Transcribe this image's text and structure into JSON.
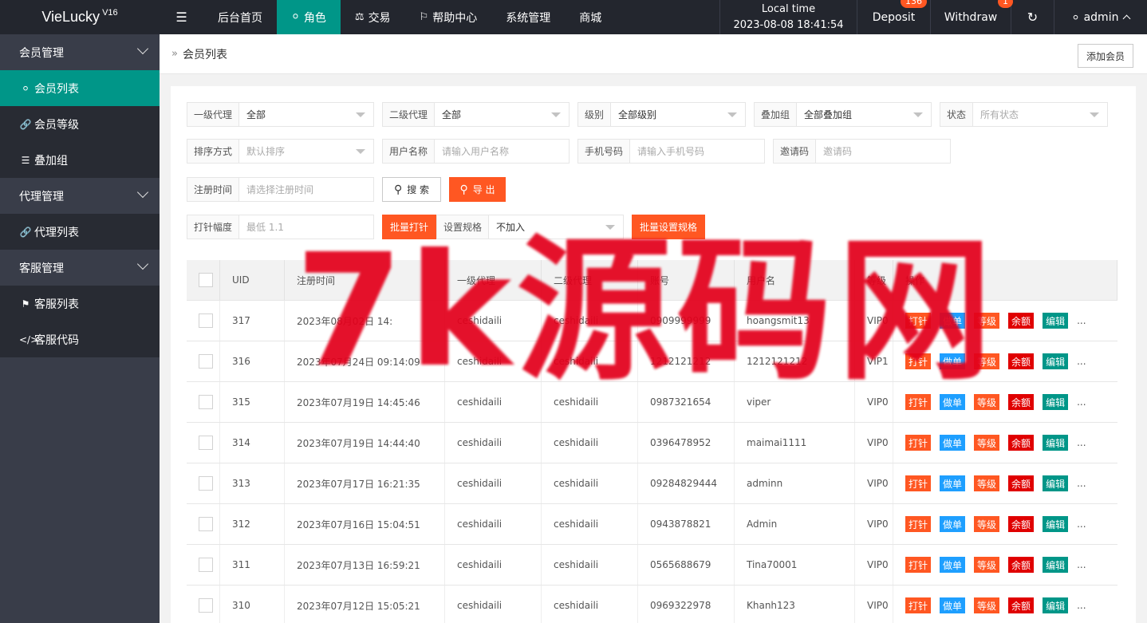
{
  "header": {
    "logo": "VieLucky",
    "logo_version": "V16",
    "menu_toggle_icon": "☰",
    "nav": [
      {
        "label": "后台首页",
        "icon": ""
      },
      {
        "label": "角色",
        "icon": "user-icon"
      },
      {
        "label": "交易",
        "icon": "scale-icon"
      },
      {
        "label": "帮助中心",
        "icon": "flag-icon"
      },
      {
        "label": "系统管理",
        "icon": ""
      },
      {
        "label": "商城",
        "icon": ""
      }
    ],
    "local_time_label": "Local time",
    "local_time_value": "2023-08-08 18:41:54",
    "deposit_label": "Deposit",
    "deposit_badge": "136",
    "withdraw_label": "Withdraw",
    "withdraw_badge": "1",
    "refresh_icon": "↻",
    "user_label": "admin",
    "badge_color": "#ff5722",
    "accent_color": "#009688"
  },
  "sidebar": {
    "groups": [
      {
        "label": "会员管理",
        "items": [
          {
            "label": "会员列表",
            "icon": "user-icon",
            "active": true
          },
          {
            "label": "会员等级",
            "icon": "link-icon"
          },
          {
            "label": "叠加组",
            "icon": "list-icon"
          }
        ]
      },
      {
        "label": "代理管理",
        "items": [
          {
            "label": "代理列表",
            "icon": "link-icon"
          }
        ]
      },
      {
        "label": "客服管理",
        "items": [
          {
            "label": "客服列表",
            "icon": "users-icon"
          },
          {
            "label": "客服代码",
            "icon": "code-icon"
          }
        ]
      }
    ]
  },
  "breadcrumb": {
    "current": "会员列表"
  },
  "add_member_label": "添加会员",
  "filters": {
    "agent1": {
      "label": "一级代理",
      "value": "全部"
    },
    "agent2": {
      "label": "二级代理",
      "value": "全部"
    },
    "level": {
      "label": "级别",
      "value": "全部级别"
    },
    "stack": {
      "label": "叠加组",
      "value": "全部叠加组"
    },
    "status": {
      "label": "状态",
      "placeholder": "所有状态"
    },
    "sort": {
      "label": "排序方式",
      "placeholder": "默认排序"
    },
    "username": {
      "label": "用户名称",
      "placeholder": "请输入用户名称"
    },
    "phone": {
      "label": "手机号码",
      "placeholder": "请输入手机号码"
    },
    "invite": {
      "label": "邀请码",
      "placeholder": "邀请码"
    },
    "regtime": {
      "label": "注册时间",
      "placeholder": "请选择注册时间"
    },
    "search_label": "搜 索",
    "export_label": "导 出",
    "inject": {
      "label": "打针幅度",
      "placeholder": "最低 1.1"
    },
    "batch_inject_label": "批量打针",
    "spec": {
      "label": "设置规格",
      "value": "不加入"
    },
    "batch_spec_label": "批量设置规格"
  },
  "table": {
    "columns": [
      "UID",
      "注册时间",
      "一级代理",
      "二级代理",
      "账号",
      "用户名",
      "等级",
      "操作"
    ],
    "actions": [
      "打针",
      "做单",
      "等级",
      "余额",
      "编辑"
    ],
    "more": "...",
    "rows": [
      {
        "uid": "317",
        "time": "2023年08月02日 14:",
        "agent1": "ceshidaili",
        "agent2": "ceshidaili",
        "account": "0909999999",
        "username": "hoangsmit13",
        "level": "VIP0"
      },
      {
        "uid": "316",
        "time": "2023年07月24日 09:14:09",
        "agent1": "ceshidaili",
        "agent2": "ceshidaili",
        "account": "1212121212",
        "username": "1212121212",
        "level": "VIP1"
      },
      {
        "uid": "315",
        "time": "2023年07月19日 14:45:46",
        "agent1": "ceshidaili",
        "agent2": "ceshidaili",
        "account": "0987321654",
        "username": "viper",
        "level": "VIP0"
      },
      {
        "uid": "314",
        "time": "2023年07月19日 14:44:40",
        "agent1": "ceshidaili",
        "agent2": "ceshidaili",
        "account": "0396478952",
        "username": "maimai1111",
        "level": "VIP0"
      },
      {
        "uid": "313",
        "time": "2023年07月17日 16:21:35",
        "agent1": "ceshidaili",
        "agent2": "ceshidaili",
        "account": "09284829444",
        "username": "adminn",
        "level": "VIP0"
      },
      {
        "uid": "312",
        "time": "2023年07月16日 15:04:51",
        "agent1": "ceshidaili",
        "agent2": "ceshidaili",
        "account": "0943878821",
        "username": "Admin",
        "level": "VIP0"
      },
      {
        "uid": "311",
        "time": "2023年07月13日 16:59:21",
        "agent1": "ceshidaili",
        "agent2": "ceshidaili",
        "account": "0565688679",
        "username": "Tina70001",
        "level": "VIP0"
      },
      {
        "uid": "310",
        "time": "2023年07月12日 15:05:21",
        "agent1": "ceshidaili",
        "agent2": "ceshidaili",
        "account": "0969322978",
        "username": "Khanh123",
        "level": "VIP0"
      }
    ]
  },
  "watermark": "7k源码网"
}
